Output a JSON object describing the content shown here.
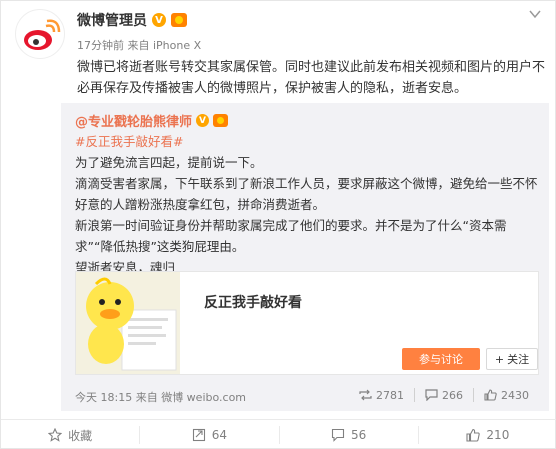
{
  "post": {
    "author": "微博管理员",
    "meta_time": "17分钟前",
    "meta_source": "来自 iPhone X",
    "text": "微博已将逝者账号转交其家属保管。同时也建议此前发布相关视频和图片的用户不必再保存及传播被害人的微博照片，保护被害人的隐私，逝者安息。"
  },
  "repost": {
    "author": "@专业戳轮胎熊律师",
    "topic": "#反正我手敲好看#",
    "lines": [
      "为了避免流言四起，提前说一下。",
      "滴滴受害者家属，下午联系到了新浪工作人员，要求屏蔽这个微博，避免给一些不怀好意的人蹭粉涨热度拿红包，拼命消费逝者。",
      "新浪第一时间验证身份并帮助家属完成了他们的要求。并不是为了什么“资本需求”“降低热搜”这类狗屁理由。",
      "望逝者安息，魂归"
    ],
    "link_card": {
      "title": "反正我手敲好看",
      "join_label": "参与讨论",
      "follow_label": "关注"
    },
    "footer": {
      "time": "今天 18:15 来自 微博 weibo.com",
      "reposts": "2781",
      "comments": "266",
      "likes": "2430"
    }
  },
  "actions": {
    "collect": "收藏",
    "repost": "64",
    "comment": "56",
    "like": "210"
  },
  "colors": {
    "accent": "#eb7350",
    "button": "#ff8140",
    "meta": "#808080",
    "repost_bg": "#f2f2f5"
  },
  "icons": [
    "weibo-logo-icon",
    "verified-v-icon",
    "vip-badge-icon",
    "chevron-down-icon",
    "repost-icon",
    "comment-icon",
    "like-icon",
    "star-icon",
    "plus-icon"
  ]
}
